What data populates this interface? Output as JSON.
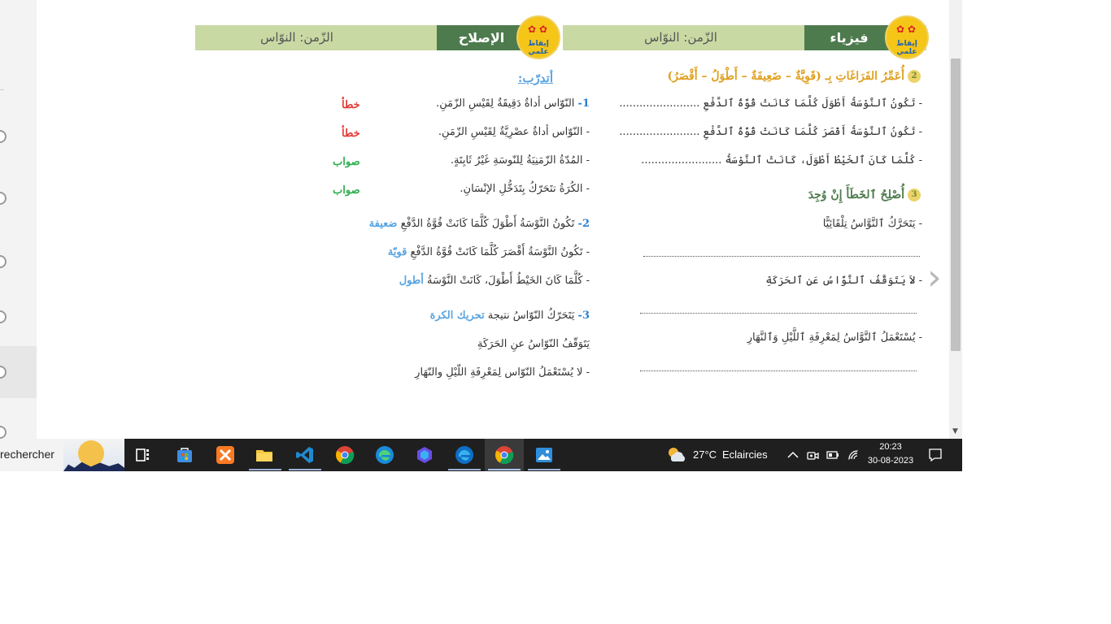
{
  "right_page": {
    "header_subject": "فيزياء",
    "header_time": "الزّمن: النوّاس",
    "logo_text": "إيقاظ علمي",
    "q2_title": "أُعَمِّرُ الفَرَاغَاتِ بِـ (قَوِيَّةٌ – ضَعِيفَةٌ – أَطْوَلُ – أَقْصَرُ)",
    "q2_lines": [
      "- تَكُونُ ٱلنَّوْسَةُ أَطْوَلَ كُلَّمَا كَانَتْ قُوَّةُ ٱلدَّفْعِ ........................",
      "- تَكُونُ ٱلنَّوْسَةُ أَقْصَرَ كُلَّمَا كَانَتْ قُوَّةُ ٱلدَّفْعِ ........................",
      "- كُلَّمَا كَانَ ٱلخَيْطُ أَطْوَلَ، كَانَتْ ٱلنَّوْسَةُ ........................"
    ],
    "q3_title": "أُصْلِحُ ٱلخَطَأَ إِنْ وُجِدَ",
    "q3_lines": [
      "- يَتَحَرَّكُ ٱلنَّوَّاسُ تِلْقَائِيًّا",
      "- لاَ يَتَوَقَّفُ ٱلنَّوَّاسُ عَنِ ٱلحَرَكَةِ",
      "- يُسْتَعْمَلُ ٱلنَّوَّاسُ لِمَعْرِفَةِ ٱللَّيْلِ وَٱلنَّهَارِ"
    ]
  },
  "left_page": {
    "header_title": "الإصلاح",
    "header_time": "الزّمن: النوّاس",
    "logo_text": "إيقاظ علمي",
    "training": "أتدرّب:",
    "q1_number": "1-",
    "q1_items": [
      {
        "text": "النّوّاس أداةٌ دَقِيقَةٌ لِقَيْسِ الزّمَنِ.",
        "answer": "خطأ",
        "correct": false
      },
      {
        "text": "- النّوّاس أداةٌ عصْرِيَّةٌ لِقَيْسِ الزّمَنِ.",
        "answer": "خطأ",
        "correct": false
      },
      {
        "text": "- المُدّةُ الزّمَنِيَةُ لِلنّوسَةِ غَيْرُ ثَابِتَةٍ.",
        "answer": "صواب",
        "correct": true
      },
      {
        "text": "- الكُرَةُ تتَحَرّكُ بِتَدَخُّلِ الإنْسَانِ.",
        "answer": "صواب",
        "correct": true
      }
    ],
    "q2_number": "2-",
    "q2_items": [
      {
        "text": "تَكُونُ النَّوْسَةُ أَطْوَلَ كُلَّمَا كَانَتْ قُوَّةُ الدَّفْعِ",
        "answer": "ضعيفة"
      },
      {
        "text": "- تَكُونُ النَّوْسَةُ أَقْصَرَ كُلَّمَا كَانَتْ قُوَّةُ الدَّفْعِ",
        "answer": "قويّة"
      },
      {
        "text": "- كُلَّمَا كَانَ الخَيْطُ أَطْوَلَ، كَانَتْ النَّوْسَةُ",
        "answer": "أطول"
      }
    ],
    "q3_number": "3-",
    "q3_items": [
      {
        "text": "يَتَحَرّكُ النّوّاسُ نتيجة",
        "answer": "تحريك الكرة"
      },
      {
        "text": "يَتَوَقّفُ النّوّاسُ عنِ الحَرَكَةِ",
        "answer": ""
      },
      {
        "text": "- لا يُسْتَعْمَلُ النّوّاس لِمَعْرِفَةِ اللّيْلِ والنّهَارِ",
        "answer": ""
      }
    ]
  },
  "taskbar": {
    "search_label": "rechercher",
    "weather_temp": "27°C",
    "weather_text": "Eclaircies",
    "time": "20:23",
    "date": "30-08-2023"
  },
  "colors": {
    "header_bar": "#c8d9a4",
    "header_dark": "#4e7b4e",
    "wrong": "#e53935",
    "right": "#2eaf4f",
    "answer_blue": "#5aa4e0",
    "q2_title_orange": "#e0a020",
    "q3_title_green": "#4e7b4e"
  }
}
